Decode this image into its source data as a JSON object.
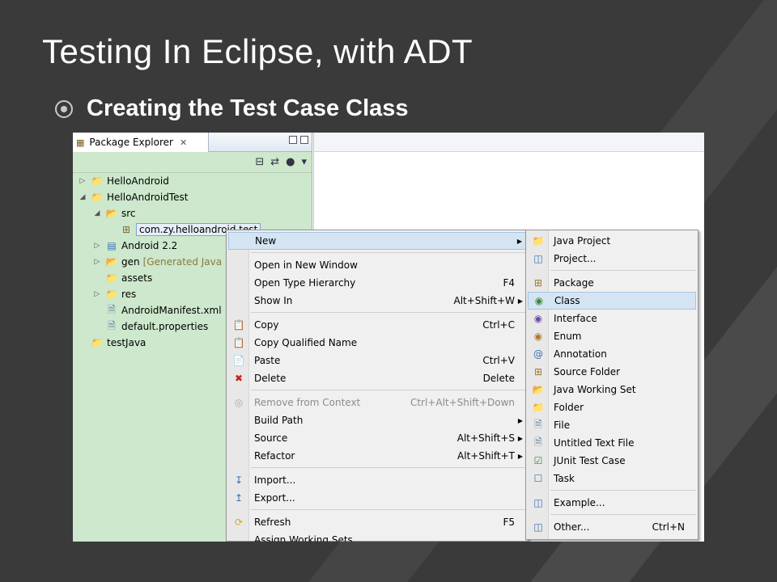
{
  "slide": {
    "title": "Testing In Eclipse, with ADT",
    "bullet": "Creating the Test Case Class"
  },
  "package_explorer": {
    "tab_label": "Package Explorer",
    "tree": [
      {
        "label": "HelloAndroid",
        "icon": "android-project-icon",
        "expanded": false
      },
      {
        "label": "HelloAndroidTest",
        "icon": "android-project-icon",
        "expanded": true
      },
      {
        "label": "src",
        "icon": "source-folder-icon",
        "expanded": true
      },
      {
        "label": "com.zy.helloandroid.test",
        "icon": "package-icon",
        "selected": true
      },
      {
        "label": "Android 2.2",
        "icon": "library-icon",
        "expanded": false
      },
      {
        "label": "gen",
        "suffix": "[Generated Java F",
        "icon": "source-folder-icon",
        "expanded": false
      },
      {
        "label": "assets",
        "icon": "folder-icon"
      },
      {
        "label": "res",
        "icon": "folder-icon",
        "expanded": false
      },
      {
        "label": "AndroidManifest.xml",
        "icon": "xml-file-icon"
      },
      {
        "label": "default.properties",
        "icon": "file-icon"
      },
      {
        "label": "testJava",
        "icon": "project-icon"
      }
    ]
  },
  "context_menu": {
    "items": [
      {
        "label": "New",
        "shortcut": "",
        "submenu": true,
        "highlighted": true
      },
      {
        "label": "Open in New Window",
        "shortcut": ""
      },
      {
        "label": "Open Type Hierarchy",
        "shortcut": "F4"
      },
      {
        "label": "Show In",
        "shortcut": "Alt+Shift+W",
        "submenu": true
      },
      {
        "label": "Copy",
        "shortcut": "Ctrl+C",
        "icon": "copy-icon"
      },
      {
        "label": "Copy Qualified Name",
        "shortcut": "",
        "icon": "copy-qualified-icon"
      },
      {
        "label": "Paste",
        "shortcut": "Ctrl+V",
        "icon": "paste-icon"
      },
      {
        "label": "Delete",
        "shortcut": "Delete",
        "icon": "delete-icon"
      },
      {
        "label": "Remove from Context",
        "shortcut": "Ctrl+Alt+Shift+Down",
        "disabled": true,
        "icon": "remove-context-icon"
      },
      {
        "label": "Build Path",
        "shortcut": "",
        "submenu": true
      },
      {
        "label": "Source",
        "shortcut": "Alt+Shift+S",
        "submenu": true
      },
      {
        "label": "Refactor",
        "shortcut": "Alt+Shift+T",
        "submenu": true
      },
      {
        "label": "Import...",
        "shortcut": "",
        "icon": "import-icon"
      },
      {
        "label": "Export...",
        "shortcut": "",
        "icon": "export-icon"
      },
      {
        "label": "Refresh",
        "shortcut": "F5",
        "icon": "refresh-icon"
      },
      {
        "label": "Assign Working Sets...",
        "shortcut": ""
      }
    ]
  },
  "new_submenu": {
    "items": [
      {
        "label": "Java Project",
        "icon": "java-project-icon"
      },
      {
        "label": "Project...",
        "icon": "project-wizard-icon"
      },
      {
        "label": "Package",
        "icon": "package-icon"
      },
      {
        "label": "Class",
        "icon": "class-icon",
        "highlighted": true
      },
      {
        "label": "Interface",
        "icon": "interface-icon"
      },
      {
        "label": "Enum",
        "icon": "enum-icon"
      },
      {
        "label": "Annotation",
        "icon": "annotation-icon"
      },
      {
        "label": "Source Folder",
        "icon": "source-folder-icon"
      },
      {
        "label": "Java Working Set",
        "icon": "working-set-icon"
      },
      {
        "label": "Folder",
        "icon": "folder-icon"
      },
      {
        "label": "File",
        "icon": "file-icon"
      },
      {
        "label": "Untitled Text File",
        "icon": "text-file-icon"
      },
      {
        "label": "JUnit Test Case",
        "icon": "junit-icon"
      },
      {
        "label": "Task",
        "icon": "task-icon"
      },
      {
        "label": "Example...",
        "icon": "example-icon"
      },
      {
        "label": "Other...",
        "shortcut": "Ctrl+N",
        "icon": "other-icon"
      }
    ]
  },
  "colors": {
    "slide_bg": "#3a3a3a",
    "explorer_bg": "#cde8cc",
    "menu_bg": "#f0f0f0",
    "highlight": "#d5e4f3"
  }
}
